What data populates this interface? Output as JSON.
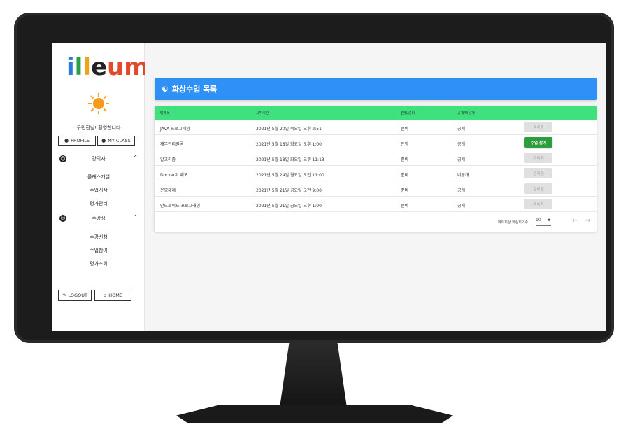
{
  "brand": {
    "logo_letters": [
      "i",
      "l",
      "l",
      "e",
      "um"
    ]
  },
  "sidebar": {
    "welcome": "구민진님! 환영합니다",
    "profile_label": "PROFILE",
    "myclass_label": "MY CLASS",
    "lecturer": {
      "label": "강의자",
      "items": [
        "클래스개설",
        "수업시작",
        "평가관리"
      ]
    },
    "student": {
      "label": "수강생",
      "items": [
        "수강신청",
        "수업참여",
        "평가조회"
      ]
    },
    "logout_label": "LOGOUT",
    "home_label": "HOME"
  },
  "main": {
    "title": "화상수업 목록",
    "columns": [
      "방제목",
      "시작시간",
      "진행/준비",
      "공개/비공개"
    ],
    "rows": [
      {
        "title": "JAVA 프로그래밍",
        "start": "2021년 5월 20일 목요일 오후 2:51",
        "status": "준비",
        "visibility": "공개",
        "action": "준비중",
        "active": false
      },
      {
        "title": "재무관리원론",
        "start": "2021년 5월 18일 화요일 오후 1:00",
        "status": "진행",
        "visibility": "공개",
        "action": "수업 참여",
        "active": true
      },
      {
        "title": "알고리즘",
        "start": "2021년 5월 18일 화요일 오후 11:13",
        "status": "준비",
        "visibility": "공개",
        "action": "준비중",
        "active": false
      },
      {
        "title": "Docker와 배포",
        "start": "2021년 5월 24일 월요일 오전 11:00",
        "status": "준비",
        "visibility": "비공개",
        "action": "준비중",
        "active": false
      },
      {
        "title": "운영체제",
        "start": "2021년 5월 21일 금요일 오전 9:00",
        "status": "준비",
        "visibility": "공개",
        "action": "준비중",
        "active": false
      },
      {
        "title": "안드로이드 프로그래밍",
        "start": "2021년 5월 21일 금요일 오후 1:00",
        "status": "준비",
        "visibility": "공개",
        "action": "준비중",
        "active": false
      }
    ],
    "footer": {
      "rows_per_page_label": "페이지당 화상회의수",
      "rows_per_page_value": "10"
    }
  },
  "colors": {
    "header_blue": "#2f90f5",
    "table_header_green": "#3fe07e",
    "join_button_green": "#2e9e3c"
  },
  "icons": [
    "person-icon",
    "account-circle-icon",
    "chevron-up-icon",
    "logout-icon",
    "home-icon",
    "video-user-icon",
    "dropdown-arrow-icon",
    "arrow-left-icon",
    "arrow-right-icon",
    "sun-icon"
  ]
}
